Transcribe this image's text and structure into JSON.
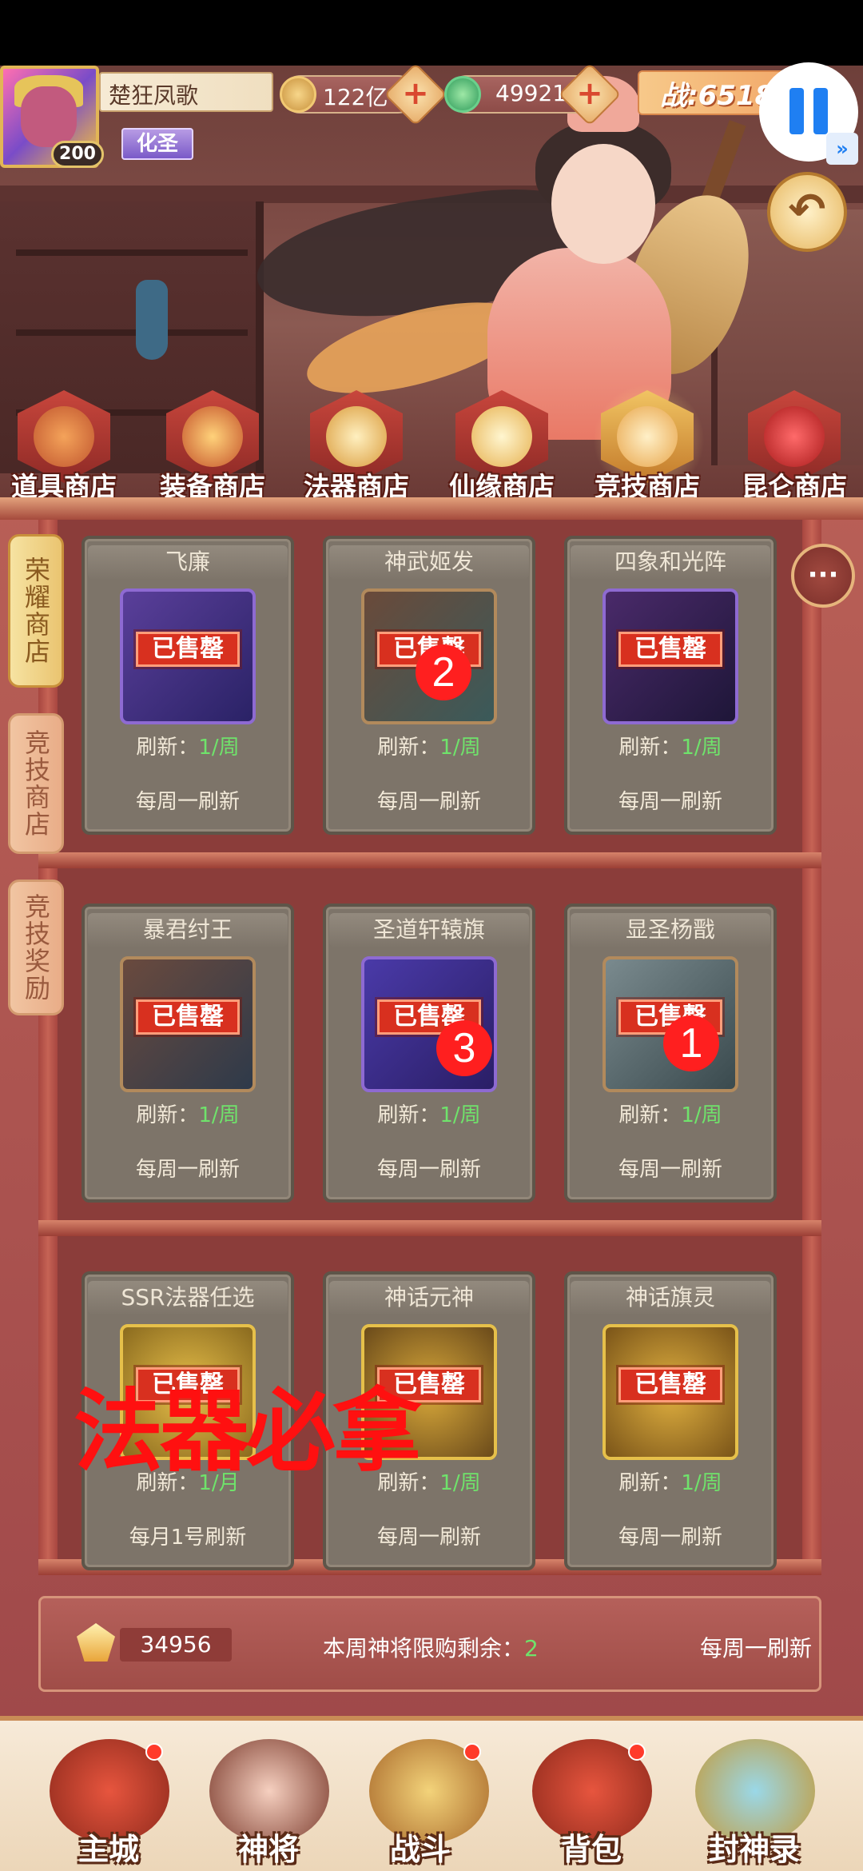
{
  "header": {
    "player_name": "楚狂凤歌",
    "level": "200",
    "title_badge": "化圣",
    "gold": "122亿",
    "jade": "49921",
    "power": "战:6518"
  },
  "category_tabs": [
    {
      "label": "道具商店",
      "icon": "pouch-icon"
    },
    {
      "label": "装备商店",
      "icon": "helmet-icon"
    },
    {
      "label": "法器商店",
      "icon": "yin-yang-icon"
    },
    {
      "label": "仙缘商店",
      "icon": "scroll-icon"
    },
    {
      "label": "竞技商店",
      "icon": "arena-emblem-icon"
    },
    {
      "label": "昆仑商店",
      "icon": "gem-orb-icon"
    }
  ],
  "side_tabs": [
    {
      "label": "荣耀商店",
      "active": true
    },
    {
      "label": "竞技商店",
      "active": false
    },
    {
      "label": "竞技奖励",
      "active": false
    }
  ],
  "items": [
    {
      "name": "飞廉",
      "status": "已售罄",
      "refresh_prefix": "刷新：",
      "refresh_count": "1",
      "refresh_unit": "/周",
      "note": "每周一刷新",
      "theme": "purple"
    },
    {
      "name": "神武姬发",
      "status": "已售罄",
      "refresh_prefix": "刷新：",
      "refresh_count": "1",
      "refresh_unit": "/周",
      "note": "每周一刷新",
      "theme": "brown"
    },
    {
      "name": "四象和光阵",
      "status": "已售罄",
      "refresh_prefix": "刷新：",
      "refresh_count": "1",
      "refresh_unit": "/周",
      "note": "每周一刷新",
      "theme": "purple"
    },
    {
      "name": "暴君纣王",
      "status": "已售罄",
      "refresh_prefix": "刷新：",
      "refresh_count": "1",
      "refresh_unit": "/周",
      "note": "每周一刷新",
      "theme": "brown"
    },
    {
      "name": "圣道轩辕旗",
      "status": "已售罄",
      "refresh_prefix": "刷新：",
      "refresh_count": "1",
      "refresh_unit": "/周",
      "note": "每周一刷新",
      "theme": "purple"
    },
    {
      "name": "显圣杨戬",
      "status": "已售罄",
      "refresh_prefix": "刷新：",
      "refresh_count": "1",
      "refresh_unit": "/周",
      "note": "每周一刷新",
      "theme": "brown"
    },
    {
      "name": "SSR法器任选",
      "status": "已售罄",
      "refresh_prefix": "刷新：",
      "refresh_count": "1",
      "refresh_unit": "/月",
      "note": "每月1号刷新",
      "theme": "gold"
    },
    {
      "name": "神话元神",
      "status": "已售罄",
      "refresh_prefix": "刷新：",
      "refresh_count": "1",
      "refresh_unit": "/周",
      "note": "每周一刷新",
      "theme": "gold"
    },
    {
      "name": "神话旗灵",
      "status": "已售罄",
      "refresh_prefix": "刷新：",
      "refresh_count": "1",
      "refresh_unit": "/周",
      "note": "每周一刷新",
      "theme": "gold"
    }
  ],
  "annotations": {
    "badges": [
      "2",
      "3",
      "1"
    ],
    "overlay_text": "法器必拿"
  },
  "footer": {
    "gem_count": "34956",
    "limit_label": "本周神将限购剩余：",
    "limit_value": "2",
    "refresh_note": "每周一刷新"
  },
  "bottom_nav": [
    {
      "label": "主城",
      "icon": "city-gate-icon"
    },
    {
      "label": "神将",
      "icon": "hero-portrait-icon"
    },
    {
      "label": "战斗",
      "icon": "crossed-swords-icon"
    },
    {
      "label": "背包",
      "icon": "backpack-icon"
    },
    {
      "label": "封神录",
      "icon": "golden-book-icon"
    }
  ],
  "colors": {
    "accent_red": "#d8301f",
    "green_count": "#6fe36b",
    "pause_blue": "#1f7ff2"
  }
}
